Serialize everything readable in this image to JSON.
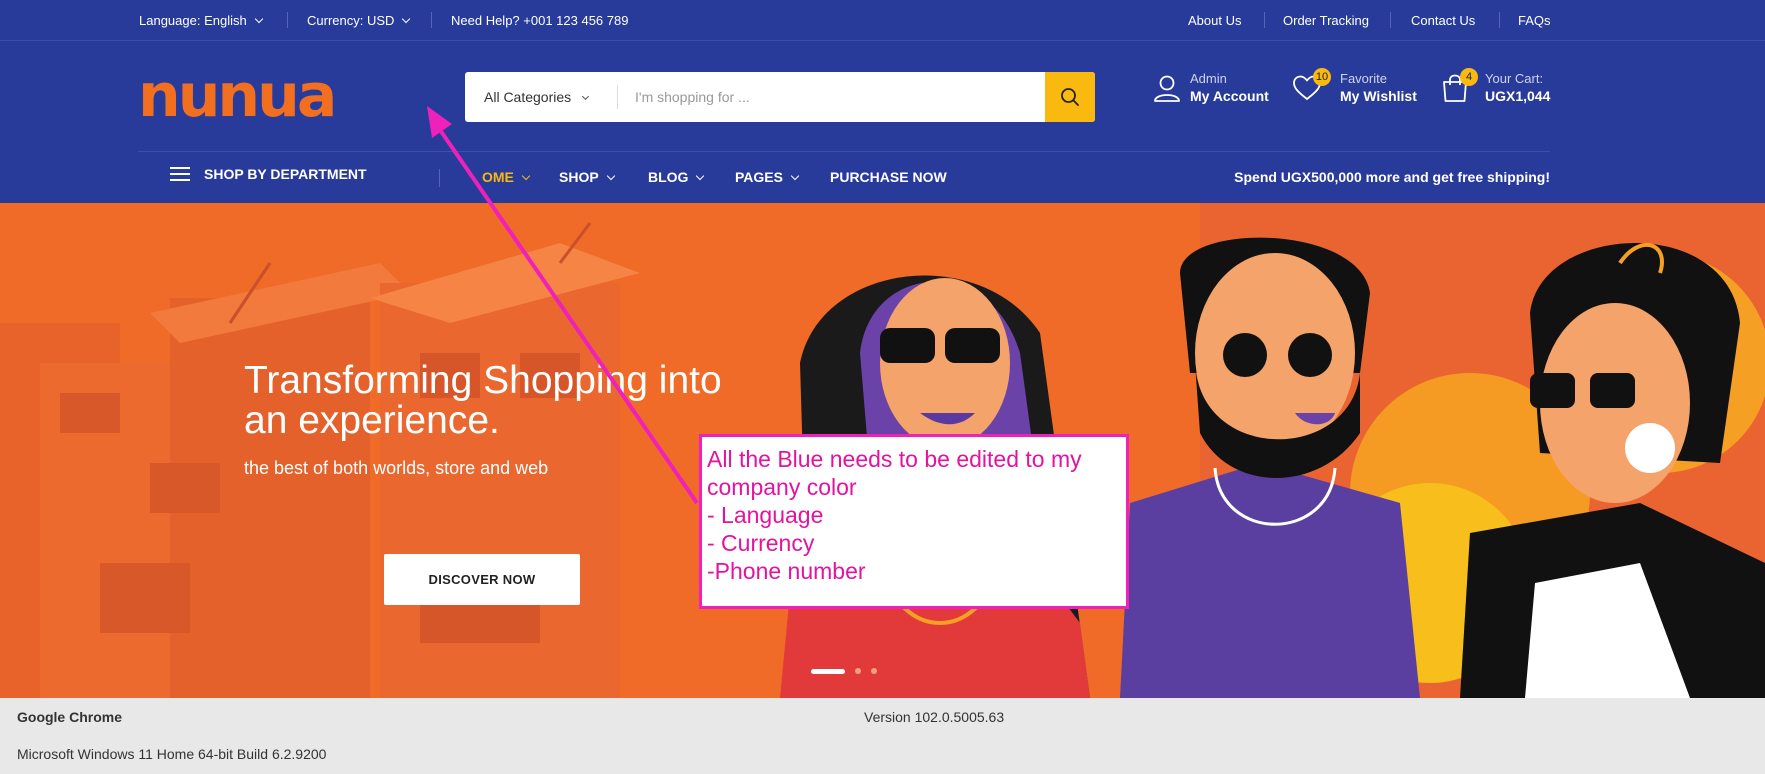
{
  "topbar": {
    "language": "Language: English",
    "currency": "Currency: USD",
    "help": "Need Help? +001 123 456 789",
    "links": [
      "About Us",
      "Order Tracking",
      "Contact Us",
      "FAQs"
    ]
  },
  "header": {
    "logo_text": "nunua",
    "search": {
      "category": "All Categories",
      "placeholder": "I'm shopping for ..."
    },
    "account": {
      "small": "Admin",
      "big": "My Account"
    },
    "wishlist": {
      "small": "Favorite",
      "big": "My Wishlist",
      "count": "10"
    },
    "cart": {
      "small": "Your Cart:",
      "big": "UGX1,044",
      "count": "4"
    }
  },
  "nav": {
    "department": "SHOP BY DEPARTMENT",
    "links": [
      "OME",
      "SHOP",
      "BLOG",
      "PAGES",
      "PURCHASE NOW"
    ],
    "promo": "Spend UGX500,000 more and get free shipping!"
  },
  "hero": {
    "title": "Transforming Shopping into an experience.",
    "subtitle": "the best of both worlds, store and web",
    "button": "DISCOVER NOW"
  },
  "annotation": {
    "lines": [
      "All the Blue needs to be edited to my",
      "company color",
      "- Language",
      "- Currency",
      "-Phone number"
    ]
  },
  "system_info": {
    "browser": "Google Chrome",
    "version": "Version 102.0.5005.63",
    "os": "Microsoft Windows 11 Home 64-bit Build 6.2.9200"
  },
  "colors": {
    "brand_blue": "#283b9b",
    "accent_yellow": "#f9b90f",
    "hero_orange": "#f06a28",
    "annotation_pink": "#ee22bb"
  }
}
